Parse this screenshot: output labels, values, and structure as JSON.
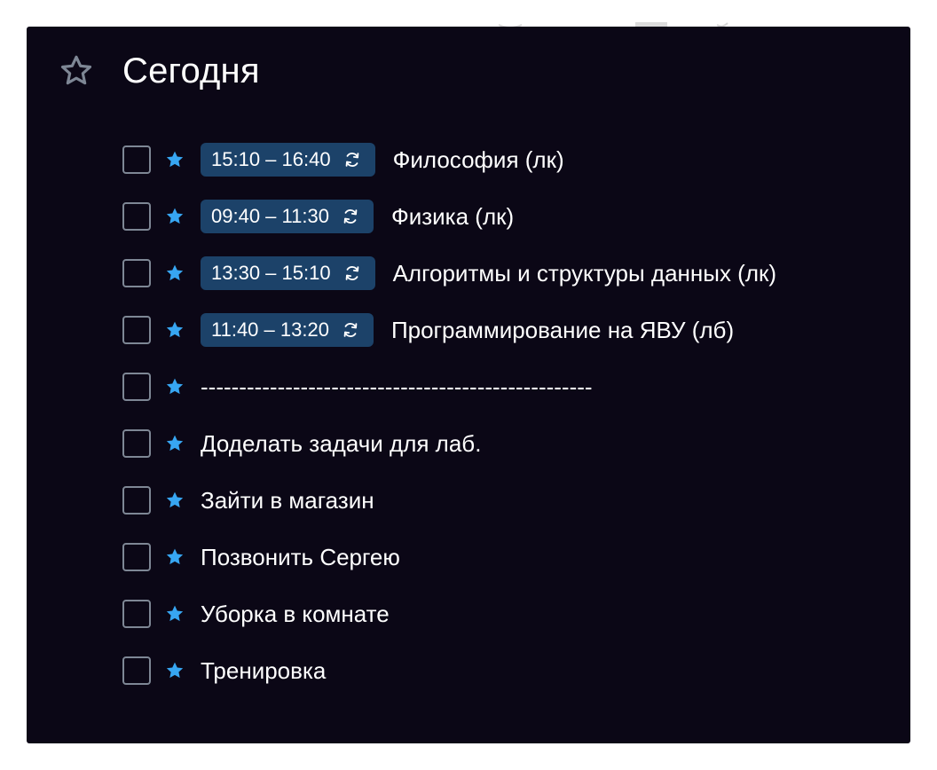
{
  "colors": {
    "panel_background": "#0b0716",
    "title_text": "#ffffff",
    "star_accent": "#37a6f2",
    "time_badge_background": "#1c4269",
    "checkbox_border": "#7e8795",
    "header_star_outline": "#7e8795"
  },
  "header": {
    "icon": "star-outline-icon",
    "title": "Сегодня"
  },
  "tasks": [
    {
      "time": "15:10 – 16:40",
      "repeat_icon": "repeat-icon",
      "title": "Философия (лк)",
      "checked": false,
      "starred": true
    },
    {
      "time": "09:40 – 11:30",
      "repeat_icon": "repeat-icon",
      "title": "Физика (лк)",
      "checked": false,
      "starred": true
    },
    {
      "time": "13:30 – 15:10",
      "repeat_icon": "repeat-icon",
      "title": "Алгоритмы и структуры данных (лк)",
      "checked": false,
      "starred": true
    },
    {
      "time": "11:40 – 13:20",
      "repeat_icon": "repeat-icon",
      "title": "Программирование на ЯВУ (лб)",
      "checked": false,
      "starred": true
    },
    {
      "title": "---------------------------------------------------",
      "checked": false,
      "starred": true
    },
    {
      "title": "Доделать задачи для лаб.",
      "checked": false,
      "starred": true
    },
    {
      "title": "Зайти в магазин",
      "checked": false,
      "starred": true
    },
    {
      "title": "Позвонить Сергею",
      "checked": false,
      "starred": true
    },
    {
      "title": "Уборка в комнате",
      "checked": false,
      "starred": true
    },
    {
      "title": "Тренировка",
      "checked": false,
      "starred": true
    }
  ]
}
